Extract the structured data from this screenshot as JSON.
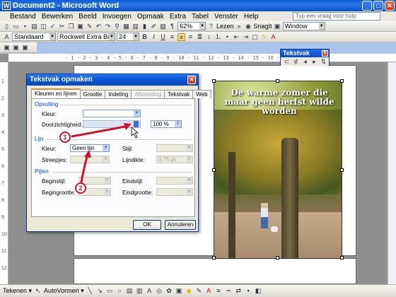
{
  "window": {
    "title": "Document2 - Microsoft Word",
    "app_icon": "W"
  },
  "menu": {
    "items": [
      "Bestand",
      "Bewerken",
      "Beeld",
      "Invoegen",
      "Opmaak",
      "Extra",
      "Tabel",
      "Venster",
      "Help"
    ],
    "help_placeholder": "Typ een vraag voor hulp"
  },
  "toolbar": {
    "zoom": "62%",
    "lezen_label": "Lezen",
    "style": "Standaard",
    "font": "Rockwell Extra Bold",
    "size": "24",
    "snagit_label": "SnagIt",
    "window_label": "Window"
  },
  "ruler": {
    "marks": "· 1 · 2 · 3 · 4 · 5 · 6 · 7 · 8 · 9 · 10 · 11 · 12 · 13 · 14 · 15 · 16 · 17 · 18 ·"
  },
  "tekstvak_toolbar": {
    "title": "Tekstvak"
  },
  "photo": {
    "caption": "De warme zomer die maar geen herfst wilde worden"
  },
  "dialog": {
    "title": "Tekstvak opmaken",
    "tabs": [
      "Kleuren en lijnen",
      "Grootte",
      "Indeling",
      "Afbeelding",
      "Tekstvak",
      "Web"
    ],
    "opvulling": {
      "group": "Opvulling",
      "kleur_label": "Kleur:",
      "doorzichtigheid_label": "Doorzichtigheid:",
      "doorzichtigheid_value": "100 %"
    },
    "lijn": {
      "group": "Lijn",
      "kleur_label": "Kleur:",
      "kleur_value": "Geen lijn",
      "stijl_label": "Stijl:",
      "streepjes_label": "Streepjes:",
      "lijndikte_label": "Lijndikte:",
      "lijndikte_value": "0,75 pt"
    },
    "pijlen": {
      "group": "Pijlen",
      "beginstijl_label": "Beginstijl:",
      "eindstijl_label": "Eindstijl:",
      "begingrootte_label": "Begingrootte:",
      "eindgrootte_label": "Eindgrootte:"
    },
    "ok_label": "OK",
    "cancel_label": "Annuleren"
  },
  "annotations": {
    "badge1": "1",
    "badge2": "2",
    "arrow_color": "#d0102c"
  },
  "drawbar": {
    "tekenen_label": "Tekenen ▾",
    "autovormen_label": "AutoVormen ▾"
  }
}
